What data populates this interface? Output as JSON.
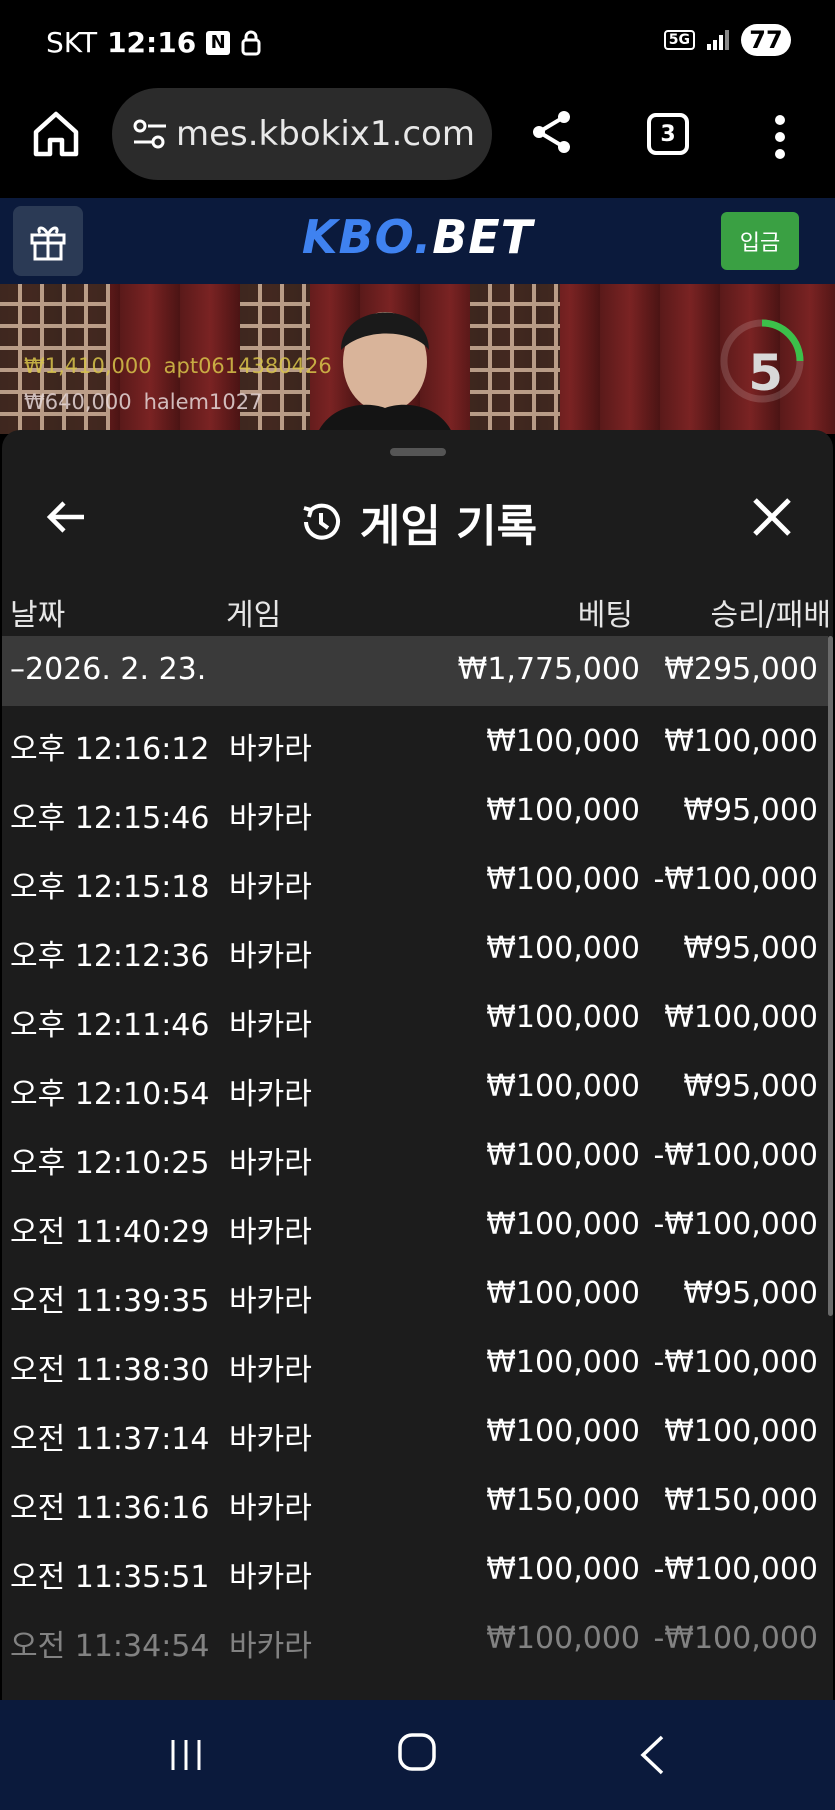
{
  "status_bar": {
    "carrier": "SKT",
    "time": "12:16",
    "network": "5G",
    "battery": "77"
  },
  "browser": {
    "url": "mes.kbokix1.com",
    "tab_count": "3"
  },
  "site": {
    "logo_part1": "KBO",
    "logo_part2": ".",
    "logo_part3": "BET",
    "deposit_label": "입금"
  },
  "video": {
    "winners": [
      {
        "amount": "₩1,410,000",
        "user": "apt0614380426"
      },
      {
        "amount": "₩640,000",
        "user": "halem1027"
      }
    ],
    "countdown": "5"
  },
  "history": {
    "title": "게임 기록",
    "columns": {
      "date": "날짜",
      "game": "게임",
      "bet": "베팅",
      "result": "승리/패배"
    },
    "summary": {
      "date": "–2026. 2. 23.",
      "bet": "₩1,775,000",
      "result": "₩295,000"
    },
    "rows": [
      {
        "time": "오후 12:16:12",
        "game": "바카라",
        "bet": "₩100,000",
        "result": "₩100,000"
      },
      {
        "time": "오후 12:15:46",
        "game": "바카라",
        "bet": "₩100,000",
        "result": "₩95,000"
      },
      {
        "time": "오후 12:15:18",
        "game": "바카라",
        "bet": "₩100,000",
        "result": "-₩100,000"
      },
      {
        "time": "오후 12:12:36",
        "game": "바카라",
        "bet": "₩100,000",
        "result": "₩95,000"
      },
      {
        "time": "오후 12:11:46",
        "game": "바카라",
        "bet": "₩100,000",
        "result": "₩100,000"
      },
      {
        "time": "오후 12:10:54",
        "game": "바카라",
        "bet": "₩100,000",
        "result": "₩95,000"
      },
      {
        "time": "오후 12:10:25",
        "game": "바카라",
        "bet": "₩100,000",
        "result": "-₩100,000"
      },
      {
        "time": "오전 11:40:29",
        "game": "바카라",
        "bet": "₩100,000",
        "result": "-₩100,000"
      },
      {
        "time": "오전 11:39:35",
        "game": "바카라",
        "bet": "₩100,000",
        "result": "₩95,000"
      },
      {
        "time": "오전 11:38:30",
        "game": "바카라",
        "bet": "₩100,000",
        "result": "-₩100,000"
      },
      {
        "time": "오전 11:37:14",
        "game": "바카라",
        "bet": "₩100,000",
        "result": "₩100,000"
      },
      {
        "time": "오전 11:36:16",
        "game": "바카라",
        "bet": "₩150,000",
        "result": "₩150,000"
      },
      {
        "time": "오전 11:35:51",
        "game": "바카라",
        "bet": "₩100,000",
        "result": "-₩100,000"
      },
      {
        "time": "오전 11:34:54",
        "game": "바카라",
        "bet": "₩100,000",
        "result": "-₩100,000"
      }
    ]
  },
  "colors": {
    "header_bg": "#0b1a3c",
    "deposit_green": "#3aa043",
    "logo_blue": "#3f82f0",
    "sheet_bg": "#1c1c1c"
  }
}
